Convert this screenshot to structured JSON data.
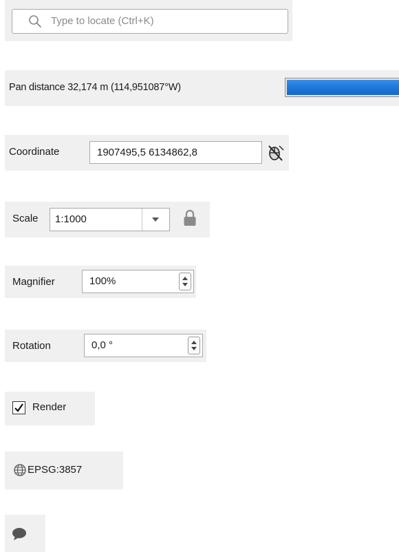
{
  "locator": {
    "placeholder": "Type to locate (Ctrl+K)",
    "icon": "search-icon"
  },
  "pan_distance": {
    "label": "Pan distance 32,174 m (114,951087°W)",
    "progress": 1.0,
    "bar_color": "#1f77d8"
  },
  "coordinate": {
    "label": "Coordinate",
    "value": "1907495,5 6134862,8",
    "toggle_icon": "mouse-pointer-toggle-icon"
  },
  "scale": {
    "label": "Scale",
    "value": "1:1000",
    "dropdown_icon": "chevron-down-icon",
    "lock_icon": "lock-icon"
  },
  "magnifier": {
    "label": "Magnifier",
    "value": "100%"
  },
  "rotation": {
    "label": "Rotation",
    "value": "0,0 °"
  },
  "render": {
    "label": "Render",
    "checked": true
  },
  "crs": {
    "label": "EPSG:3857",
    "icon": "globe-icon"
  },
  "messages": {
    "icon": "speech-bubble-icon"
  }
}
